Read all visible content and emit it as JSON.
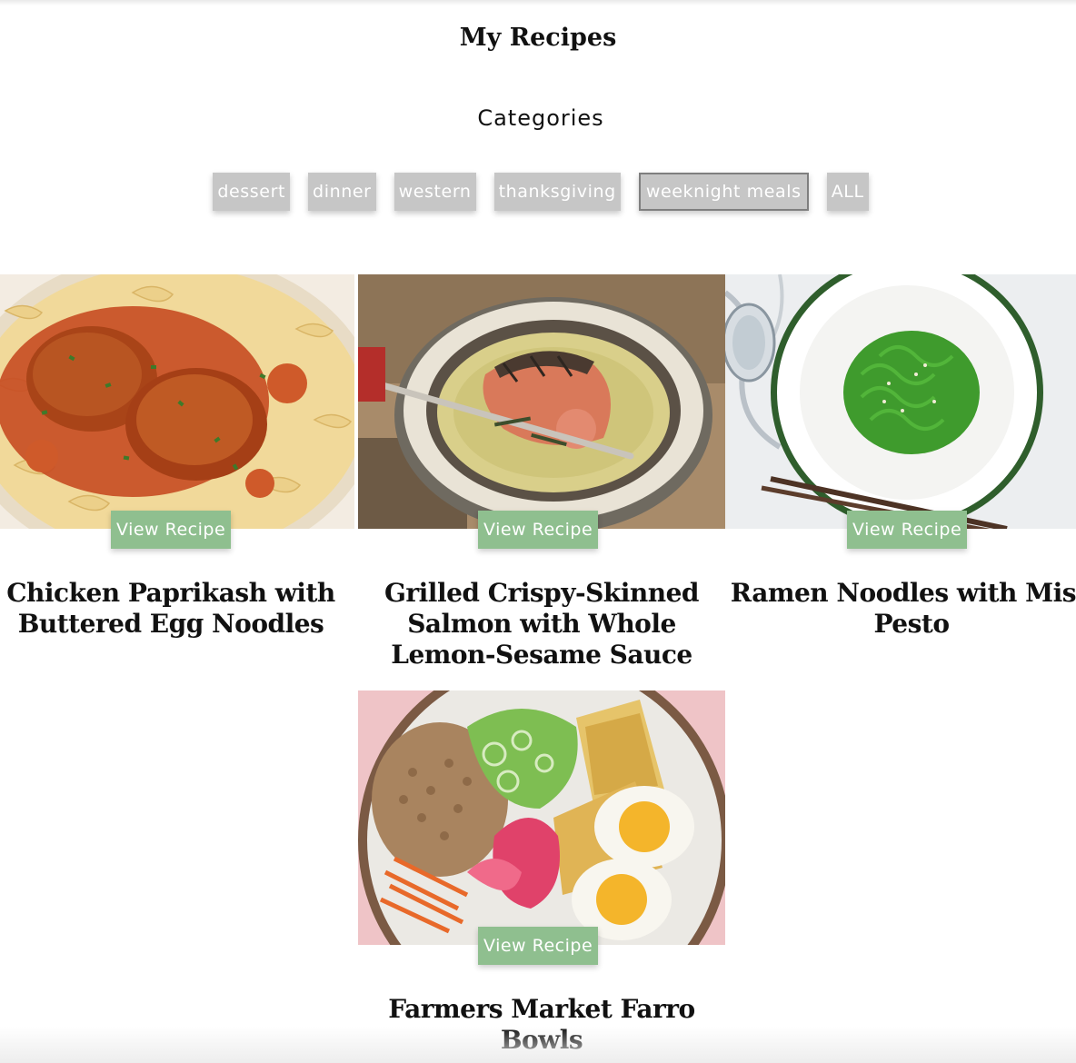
{
  "page": {
    "title": "My Recipes",
    "categories_heading": "Categories"
  },
  "categories": [
    {
      "label": "dessert",
      "active": false
    },
    {
      "label": "dinner",
      "active": false
    },
    {
      "label": "western",
      "active": false
    },
    {
      "label": "thanksgiving",
      "active": false
    },
    {
      "label": "weeknight meals",
      "active": true
    },
    {
      "label": "ALL",
      "active": false
    }
  ],
  "recipes": [
    {
      "title": "Chicken Paprikash with Buttered Egg Noodles",
      "button": "View Recipe",
      "image": "chicken-paprikash-photo"
    },
    {
      "title": "Grilled Crispy-Skinned Salmon with Whole Lemon-Sesame Sauce",
      "button": "View Recipe",
      "image": "grilled-salmon-photo"
    },
    {
      "title": "Ramen Noodles with Miso Pesto",
      "button": "View Recipe",
      "image": "ramen-miso-pesto-photo"
    },
    {
      "title": "Farmers Market Farro Bowls",
      "button": "View Recipe",
      "image": "farro-bowl-photo"
    }
  ],
  "colors": {
    "category_button_bg": "#c6c6c6",
    "view_button_bg": "#8fbf8f"
  }
}
